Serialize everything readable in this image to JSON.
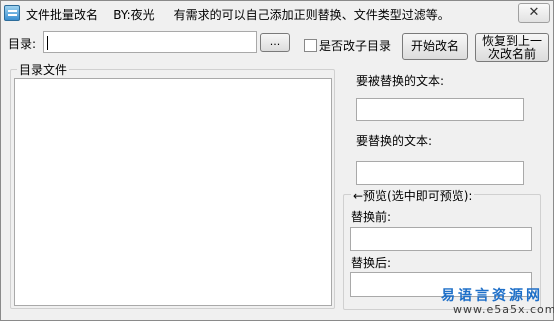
{
  "window": {
    "title": "文件批量改名    BY:夜光     有需求的可以自己添加正则替换、文件类型过滤等。",
    "close_label": "✕"
  },
  "directory": {
    "label": "目录:",
    "value": "",
    "browse_label": "..."
  },
  "subdir_checkbox": {
    "label": "是否改子目录",
    "checked": false
  },
  "buttons": {
    "start_rename": "开始改名",
    "restore_line1": "恢复到上一",
    "restore_line2": "次改名前"
  },
  "file_list": {
    "group_title": "目录文件",
    "items": []
  },
  "replace": {
    "find_label": "要被替换的文本:",
    "find_value": "",
    "replace_label": "要替换的文本:",
    "replace_value": ""
  },
  "preview": {
    "group_title": "←预览(选中即可预览):",
    "before_label": "替换前:",
    "before_value": "",
    "after_label": "替换后:",
    "after_value": ""
  },
  "watermark": {
    "site_name": "易语言资源网",
    "url": "www.e5a5x.com"
  }
}
